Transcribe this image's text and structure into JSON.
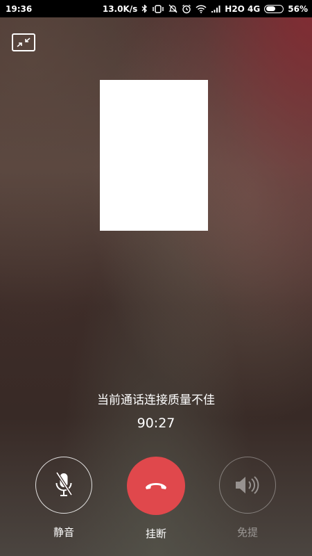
{
  "status_bar": {
    "time": "19:36",
    "network_speed": "13.0K/s",
    "carrier": "H2O 4G",
    "battery_percent": "56%",
    "battery_level": 0.56,
    "icons": [
      "bluetooth-icon",
      "vibrate-icon",
      "mute-bell-icon",
      "alarm-icon",
      "wifi-icon",
      "signal-icon",
      "battery-icon"
    ]
  },
  "call": {
    "quality_notice": "当前通话连接质量不佳",
    "duration": "90:27"
  },
  "controls": {
    "mute_label": "静音",
    "hangup_label": "挂断",
    "speaker_label": "免提"
  },
  "colors": {
    "hangup": "#e0484c",
    "status_bar_bg": "#000000",
    "text": "#ffffff"
  }
}
